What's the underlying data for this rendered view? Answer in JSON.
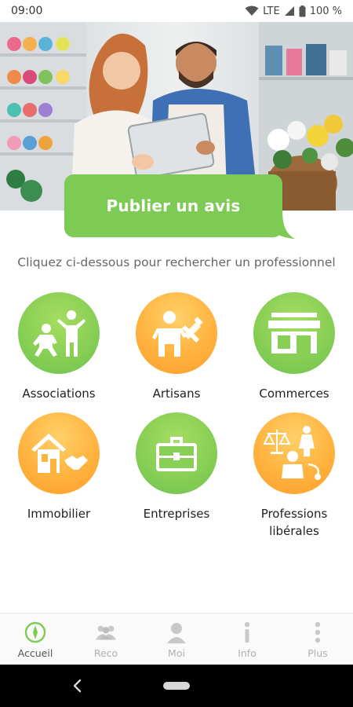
{
  "status_bar": {
    "time": "09:00",
    "network": "LTE",
    "battery": "100 %"
  },
  "hero": {
    "image": "florist-shop-photo"
  },
  "publish_button": {
    "label": "Publier un avis"
  },
  "instruction": {
    "text": "Cliquez ci-dessous pour rechercher un professionnel"
  },
  "categories": [
    {
      "label": "Associations",
      "color": "#88cf55",
      "icon": "people-icon"
    },
    {
      "label": "Artisans",
      "color": "#ffb33f",
      "icon": "worker-tools-icon"
    },
    {
      "label": "Commerces",
      "color": "#88cf55",
      "icon": "storefront-icon"
    },
    {
      "label": "Immobilier",
      "color": "#ffb33f",
      "icon": "house-handshake-icon"
    },
    {
      "label": "Entreprises",
      "color": "#88cf55",
      "icon": "briefcase-icon"
    },
    {
      "label": "Professions\nlibérales",
      "color": "#ffb33f",
      "icon": "justice-medical-icon"
    }
  ],
  "bottom_nav": {
    "items": [
      {
        "label": "Accueil",
        "icon": "compass-icon",
        "active": true
      },
      {
        "label": "Reco",
        "icon": "group-icon",
        "active": false
      },
      {
        "label": "Moi",
        "icon": "person-icon",
        "active": false
      },
      {
        "label": "Info",
        "icon": "info-icon",
        "active": false
      },
      {
        "label": "Plus",
        "icon": "more-vertical-icon",
        "active": false
      }
    ]
  },
  "colors": {
    "brand_green": "#7dcb55",
    "brand_orange": "#ffb33f",
    "active_nav_icon": "#7dcb55",
    "inactive_nav": "#b0b0b0"
  }
}
